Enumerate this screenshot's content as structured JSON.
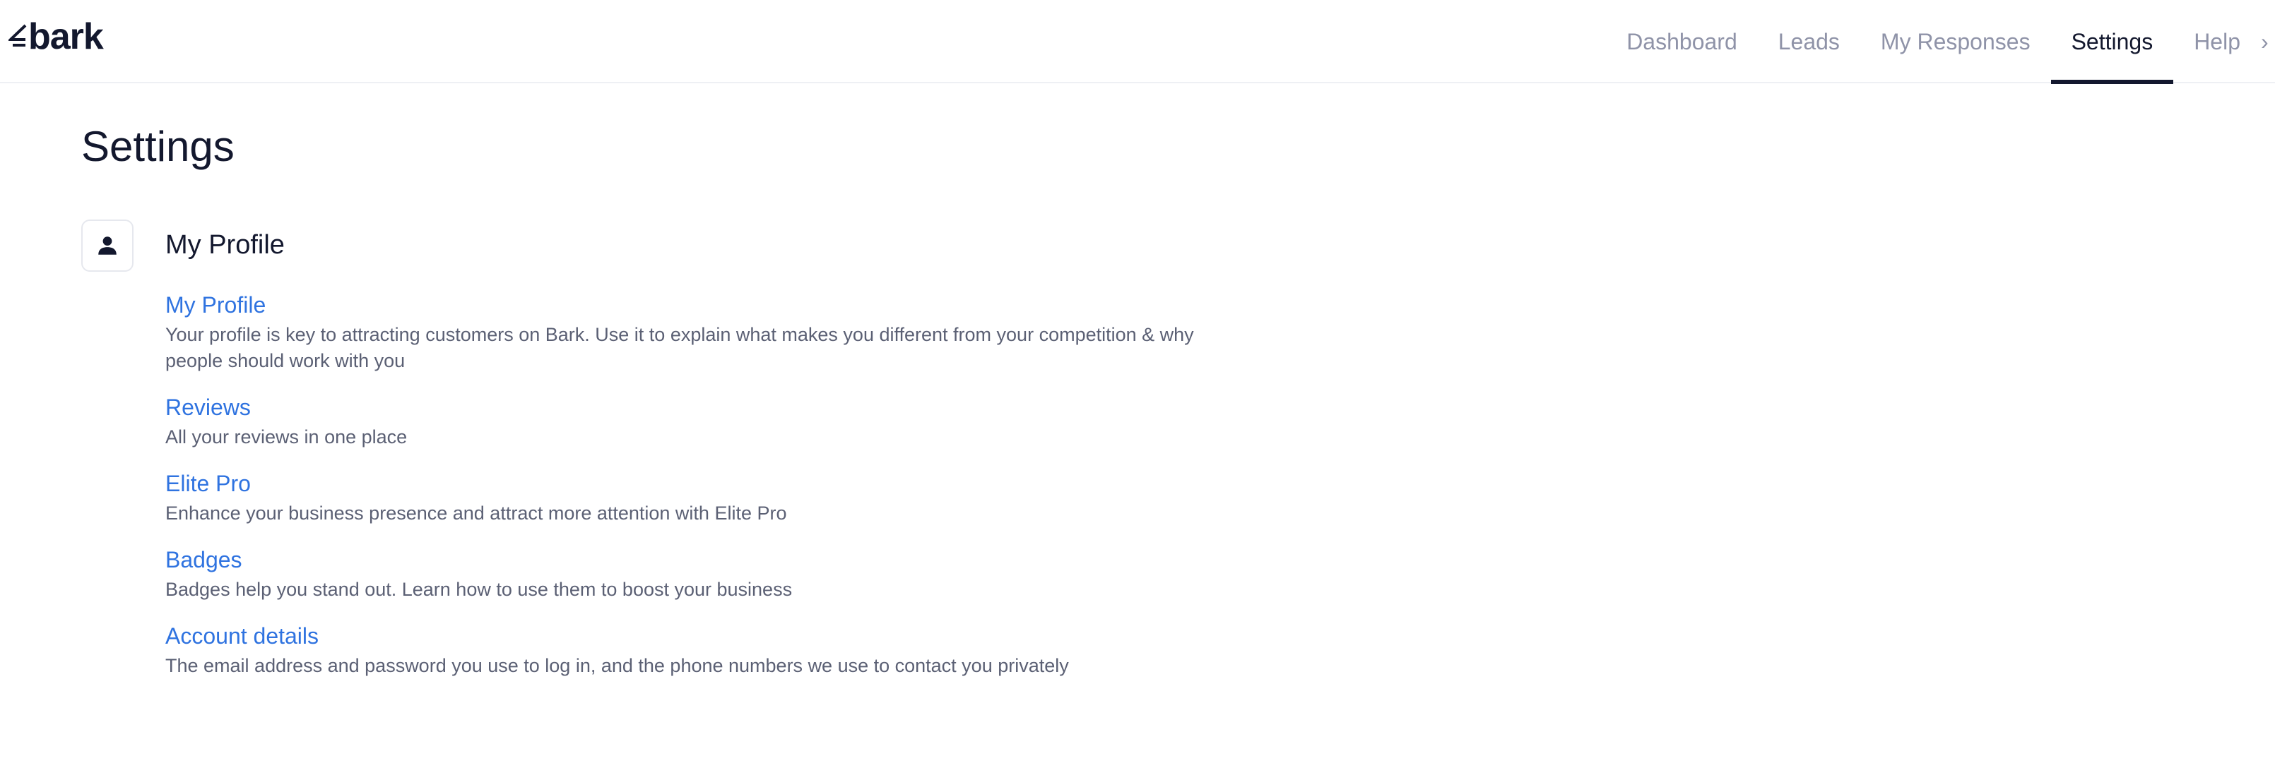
{
  "brand": {
    "name": "bark"
  },
  "nav": {
    "items": [
      {
        "label": "Dashboard",
        "active": false
      },
      {
        "label": "Leads",
        "active": false
      },
      {
        "label": "My Responses",
        "active": false
      },
      {
        "label": "Settings",
        "active": true
      },
      {
        "label": "Help",
        "active": false
      }
    ]
  },
  "page": {
    "title": "Settings"
  },
  "section": {
    "icon": "person-icon",
    "title": "My Profile",
    "links": [
      {
        "title": "My Profile",
        "description": "Your profile is key to attracting customers on Bark. Use it to explain what makes you different from your competition & why people should work with you"
      },
      {
        "title": "Reviews",
        "description": "All your reviews in one place"
      },
      {
        "title": "Elite Pro",
        "description": "Enhance your business presence and attract more attention with Elite Pro"
      },
      {
        "title": "Badges",
        "description": "Badges help you stand out. Learn how to use them to boost your business"
      },
      {
        "title": "Account details",
        "description": "The email address and password you use to log in, and the phone numbers we use to contact you privately"
      }
    ]
  },
  "colors": {
    "text_dark": "#13182e",
    "nav_inactive": "#8f93a8",
    "link": "#2f73e0",
    "description": "#5b6074"
  }
}
